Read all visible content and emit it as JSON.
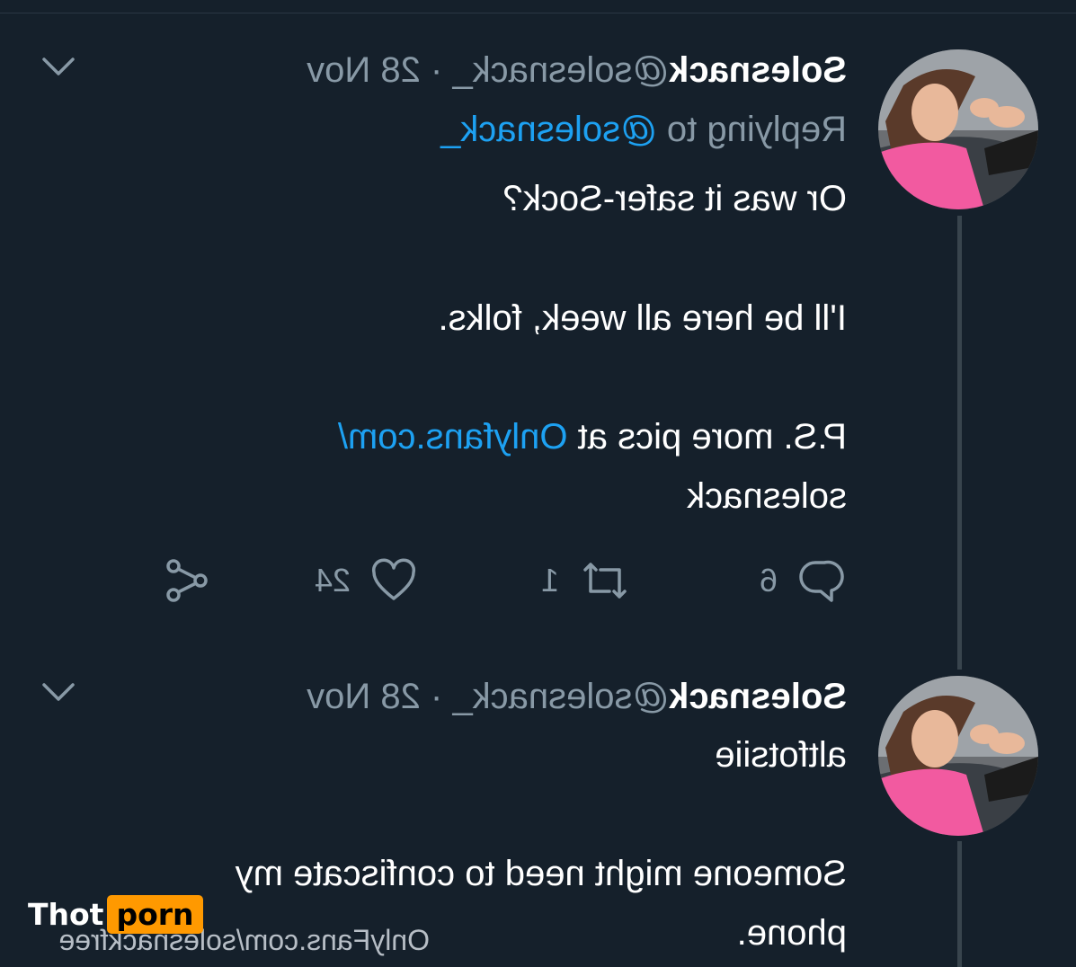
{
  "tweets": [
    {
      "author": "Solesnack",
      "handle": "@solesnack_",
      "separator": " · ",
      "date": "28 Nov",
      "reply_prefix": "Replying to ",
      "reply_to": "@solesnack_",
      "lines": [
        "Or was it safer-Sock?",
        "I'll be here all week, folks."
      ],
      "ps_text": "P.S. more pics at ",
      "ps_link_1": "Onlyfans.com/",
      "ps_link_2": "solesnack",
      "actions": {
        "replies": "6",
        "retweets": "1",
        "likes": "24"
      }
    },
    {
      "author": "Solesnack",
      "handle": "@solesnack_",
      "separator": " · ",
      "date": "28 Nov",
      "lines": [
        "altfotsiie",
        "Someone might need to confiscate my",
        "phone."
      ]
    }
  ],
  "watermark": "OnlyFans.com/solesnackfree",
  "site_logo": {
    "part1": "Thot",
    "part2": "porn"
  },
  "colors": {
    "background": "#15202b",
    "link": "#1da1f2",
    "muted": "#8899a6",
    "logo_accent": "#ff9900"
  }
}
